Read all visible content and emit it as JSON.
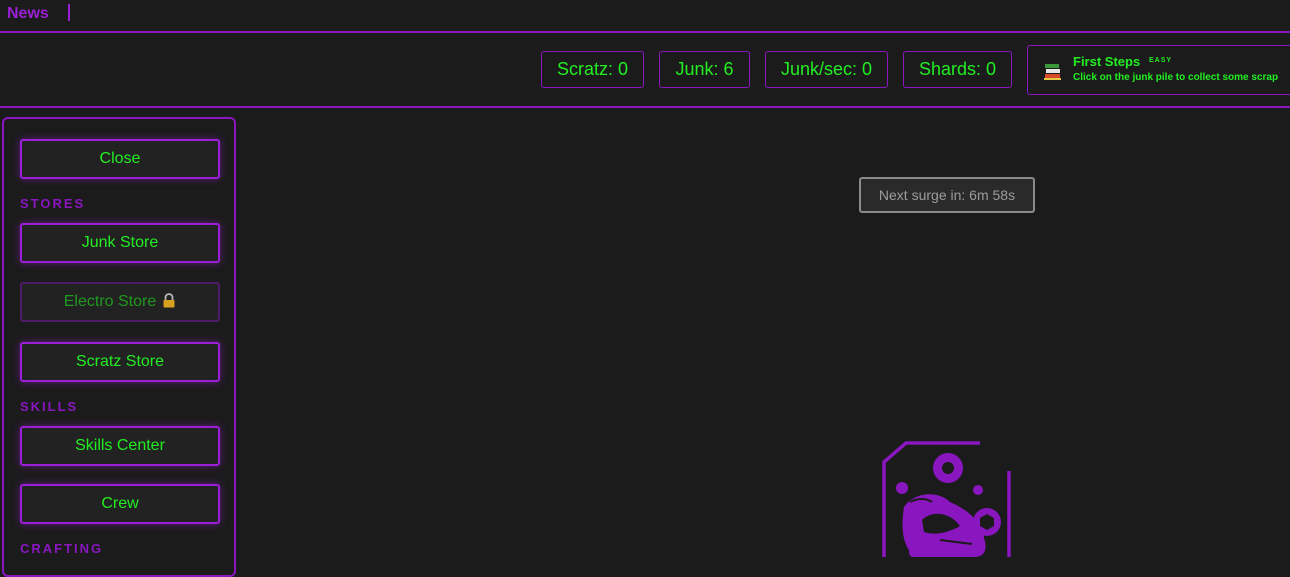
{
  "news": {
    "label": "News"
  },
  "stats": {
    "scratz": "Scratz: 0",
    "junk": "Junk: 6",
    "junk_per_sec": "Junk/sec: 0",
    "shards": "Shards: 0"
  },
  "quest": {
    "icon": "books-icon",
    "title": "First Steps",
    "difficulty": "EASY",
    "description": "Click on the junk pile to collect some scrap"
  },
  "sidebar": {
    "close_label": "Close",
    "sections": {
      "stores": "STORES",
      "skills": "SKILLS",
      "crafting": "CRAFTING"
    },
    "items": {
      "junk_store": "Junk Store",
      "electro_store": "Electro Store",
      "scratz_store": "Scratz Store",
      "skills_center": "Skills Center",
      "crew": "Crew"
    },
    "electro_store_locked": true
  },
  "surge": {
    "text": "Next surge in: 6m 58s"
  },
  "colors": {
    "background": "#1b1b1b",
    "accent_purple": "#9a1fd6",
    "text_green": "#22ee22",
    "muted_grey": "#9c9c9c"
  }
}
